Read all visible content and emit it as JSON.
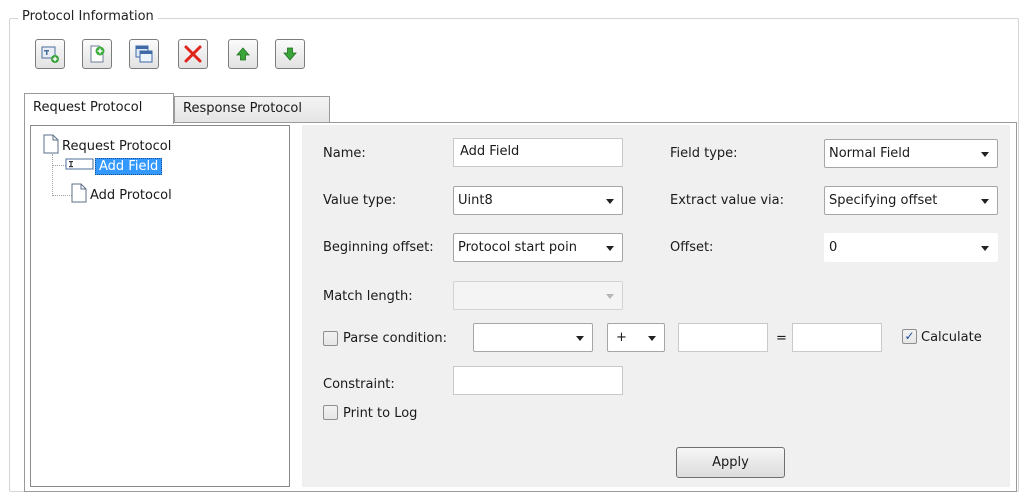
{
  "group": {
    "title": "Protocol Information"
  },
  "toolbar": {
    "buttons": [
      {
        "name": "add-field",
        "icon": "add-field-icon"
      },
      {
        "name": "add-protocol",
        "icon": "add-protocol-icon"
      },
      {
        "name": "copy",
        "icon": "copy-icon"
      },
      {
        "name": "delete",
        "icon": "delete-icon"
      },
      {
        "name": "move-up",
        "icon": "arrow-up-icon"
      },
      {
        "name": "move-down",
        "icon": "arrow-down-icon"
      }
    ]
  },
  "tabs": [
    {
      "label": "Request Protocol",
      "active": true
    },
    {
      "label": "Response Protocol",
      "active": false
    }
  ],
  "tree": {
    "root": "Request Protocol",
    "children": [
      {
        "label": "Add Field",
        "selected": true
      },
      {
        "label": "Add Protocol",
        "selected": false
      }
    ]
  },
  "form": {
    "name_label": "Name:",
    "name_value": "Add Field",
    "field_type_label": "Field type:",
    "field_type_value": "Normal Field",
    "value_type_label": "Value type:",
    "value_type_value": "Uint8",
    "extract_label": "Extract value via:",
    "extract_value": "Specifying offset",
    "begin_offset_label": "Beginning offset:",
    "begin_offset_value": "Protocol start poin",
    "offset_label": "Offset:",
    "offset_value": "0",
    "match_length_label": "Match length:",
    "match_length_value": "",
    "parse_condition_label": "Parse condition:",
    "parse_condition_checked": false,
    "parse_condition_value": "",
    "operator_value": "+",
    "operand_left_value": "",
    "equals_sign": "=",
    "operand_right_value": "",
    "calculate_label": "Calculate",
    "calculate_checked": true,
    "constraint_label": "Constraint:",
    "constraint_value": "",
    "print_log_label": "Print to Log",
    "print_log_checked": false,
    "apply_label": "Apply"
  },
  "colors": {
    "selection": "#3399ff",
    "panel_bg": "#f0f0f0",
    "delete_red": "#e0241b",
    "arrow_green": "#3aa63a"
  }
}
